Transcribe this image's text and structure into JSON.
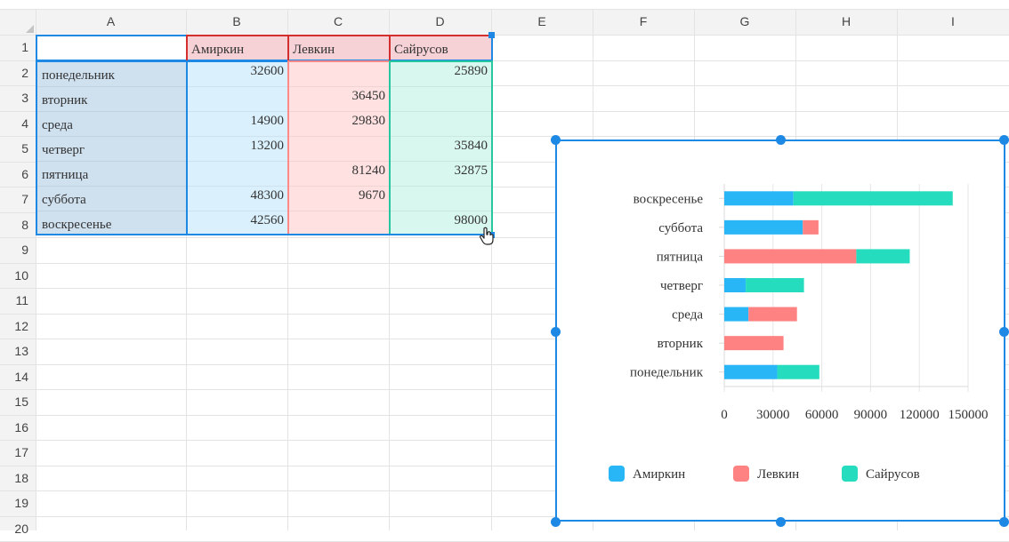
{
  "columns": [
    "A",
    "B",
    "C",
    "D",
    "E",
    "F",
    "G",
    "H",
    "I"
  ],
  "rows": [
    "1",
    "2",
    "3",
    "4",
    "5",
    "6",
    "7",
    "8",
    "9",
    "10",
    "11",
    "12",
    "13",
    "14",
    "15",
    "16",
    "17",
    "18",
    "19",
    "20"
  ],
  "table": {
    "headers": [
      "",
      "Амиркин",
      "Левкин",
      "Сайрусов"
    ],
    "rows": [
      {
        "day": "понедельник",
        "amirkin": "32600",
        "levkin": "",
        "sairusov": "25890"
      },
      {
        "day": "вторник",
        "amirkin": "",
        "levkin": "36450",
        "sairusov": ""
      },
      {
        "day": "среда",
        "amirkin": "14900",
        "levkin": "29830",
        "sairusov": ""
      },
      {
        "day": "четверг",
        "amirkin": "13200",
        "levkin": "",
        "sairusov": "35840"
      },
      {
        "day": "пятница",
        "amirkin": "",
        "levkin": "81240",
        "sairusov": "32875"
      },
      {
        "day": "суббота",
        "amirkin": "48300",
        "levkin": "9670",
        "sairusov": ""
      },
      {
        "day": "воскресенье",
        "amirkin": "42560",
        "levkin": "",
        "sairusov": "98000"
      }
    ]
  },
  "colors": {
    "amirkin": "#29b6f6",
    "levkin": "#ff8282",
    "sairusov": "#26dcbe",
    "selection": "#1e88e5",
    "header_red": "#d32f2f"
  },
  "chart_data": {
    "type": "bar",
    "orientation": "horizontal",
    "stacked": true,
    "categories": [
      "понедельник",
      "вторник",
      "среда",
      "четверг",
      "пятница",
      "суббота",
      "воскресенье"
    ],
    "series": [
      {
        "name": "Амиркин",
        "values": [
          32600,
          0,
          14900,
          13200,
          0,
          48300,
          42560
        ]
      },
      {
        "name": "Левкин",
        "values": [
          0,
          36450,
          29830,
          0,
          81240,
          9670,
          0
        ]
      },
      {
        "name": "Сайрусов",
        "values": [
          25890,
          0,
          0,
          35840,
          32875,
          0,
          98000
        ]
      }
    ],
    "xticks": [
      "0",
      "30000",
      "60000",
      "90000",
      "120000",
      "150000"
    ],
    "xlim": [
      0,
      150000
    ],
    "grid": true,
    "legend": "bottom"
  }
}
